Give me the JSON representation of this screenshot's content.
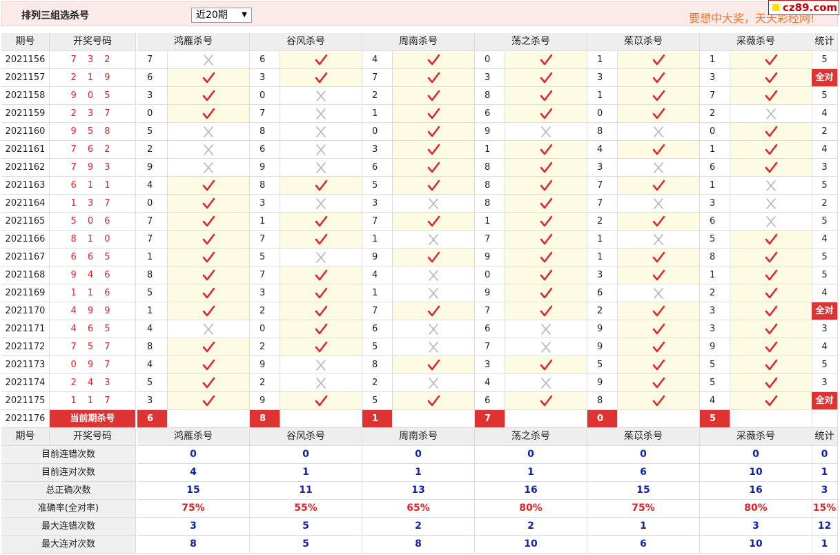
{
  "header": {
    "title": "排列三组选杀号",
    "period_select": "近20期",
    "slogan": "要想中大奖，天天彩经网!",
    "logo": "cz89.com"
  },
  "columns": {
    "period": "期号",
    "draw": "开奖号码",
    "experts": [
      "鸿雁杀号",
      "谷风杀号",
      "周南杀号",
      "荡之杀号",
      "茱苡杀号",
      "采薇杀号"
    ],
    "stat": "统计"
  },
  "rows": [
    {
      "period": "2021156",
      "draw": "7 3 2",
      "kills": [
        [
          7,
          0
        ],
        [
          6,
          1
        ],
        [
          4,
          1
        ],
        [
          0,
          1
        ],
        [
          1,
          1
        ],
        [
          1,
          1
        ]
      ],
      "stat": "5"
    },
    {
      "period": "2021157",
      "draw": "2 1 9",
      "kills": [
        [
          6,
          1
        ],
        [
          3,
          1
        ],
        [
          7,
          1
        ],
        [
          3,
          1
        ],
        [
          3,
          1
        ],
        [
          3,
          1
        ]
      ],
      "stat": "全对"
    },
    {
      "period": "2021158",
      "draw": "9 0 5",
      "kills": [
        [
          3,
          1
        ],
        [
          0,
          0
        ],
        [
          2,
          1
        ],
        [
          8,
          1
        ],
        [
          1,
          1
        ],
        [
          7,
          1
        ]
      ],
      "stat": "5"
    },
    {
      "period": "2021159",
      "draw": "2 3 7",
      "kills": [
        [
          0,
          1
        ],
        [
          7,
          0
        ],
        [
          1,
          1
        ],
        [
          6,
          1
        ],
        [
          0,
          1
        ],
        [
          2,
          0
        ]
      ],
      "stat": "4"
    },
    {
      "period": "2021160",
      "draw": "9 5 8",
      "kills": [
        [
          5,
          0
        ],
        [
          8,
          0
        ],
        [
          0,
          1
        ],
        [
          9,
          0
        ],
        [
          8,
          0
        ],
        [
          0,
          1
        ]
      ],
      "stat": "2"
    },
    {
      "period": "2021161",
      "draw": "7 6 2",
      "kills": [
        [
          2,
          0
        ],
        [
          6,
          0
        ],
        [
          3,
          1
        ],
        [
          1,
          1
        ],
        [
          4,
          1
        ],
        [
          1,
          1
        ]
      ],
      "stat": "4"
    },
    {
      "period": "2021162",
      "draw": "7 9 3",
      "kills": [
        [
          9,
          0
        ],
        [
          9,
          0
        ],
        [
          6,
          1
        ],
        [
          8,
          1
        ],
        [
          3,
          0
        ],
        [
          6,
          1
        ]
      ],
      "stat": "3"
    },
    {
      "period": "2021163",
      "draw": "6 1 1",
      "kills": [
        [
          4,
          1
        ],
        [
          8,
          1
        ],
        [
          5,
          1
        ],
        [
          8,
          1
        ],
        [
          7,
          1
        ],
        [
          1,
          0
        ]
      ],
      "stat": "5"
    },
    {
      "period": "2021164",
      "draw": "1 3 7",
      "kills": [
        [
          0,
          1
        ],
        [
          3,
          0
        ],
        [
          3,
          0
        ],
        [
          8,
          1
        ],
        [
          7,
          0
        ],
        [
          3,
          0
        ]
      ],
      "stat": "2"
    },
    {
      "period": "2021165",
      "draw": "5 0 6",
      "kills": [
        [
          7,
          1
        ],
        [
          1,
          1
        ],
        [
          7,
          1
        ],
        [
          1,
          1
        ],
        [
          2,
          1
        ],
        [
          6,
          0
        ]
      ],
      "stat": "5"
    },
    {
      "period": "2021166",
      "draw": "8 1 0",
      "kills": [
        [
          7,
          1
        ],
        [
          7,
          1
        ],
        [
          1,
          0
        ],
        [
          7,
          1
        ],
        [
          1,
          0
        ],
        [
          5,
          1
        ]
      ],
      "stat": "4"
    },
    {
      "period": "2021167",
      "draw": "6 6 5",
      "kills": [
        [
          1,
          1
        ],
        [
          5,
          0
        ],
        [
          9,
          1
        ],
        [
          9,
          1
        ],
        [
          1,
          1
        ],
        [
          8,
          1
        ]
      ],
      "stat": "5"
    },
    {
      "period": "2021168",
      "draw": "9 4 6",
      "kills": [
        [
          8,
          1
        ],
        [
          7,
          1
        ],
        [
          4,
          0
        ],
        [
          0,
          1
        ],
        [
          3,
          1
        ],
        [
          1,
          1
        ]
      ],
      "stat": "5"
    },
    {
      "period": "2021169",
      "draw": "1 1 6",
      "kills": [
        [
          5,
          1
        ],
        [
          3,
          1
        ],
        [
          1,
          0
        ],
        [
          9,
          1
        ],
        [
          6,
          0
        ],
        [
          2,
          1
        ]
      ],
      "stat": "4"
    },
    {
      "period": "2021170",
      "draw": "4 9 9",
      "kills": [
        [
          1,
          1
        ],
        [
          2,
          1
        ],
        [
          7,
          1
        ],
        [
          7,
          1
        ],
        [
          2,
          1
        ],
        [
          3,
          1
        ]
      ],
      "stat": "全对"
    },
    {
      "period": "2021171",
      "draw": "4 6 5",
      "kills": [
        [
          4,
          0
        ],
        [
          0,
          1
        ],
        [
          6,
          0
        ],
        [
          6,
          0
        ],
        [
          9,
          1
        ],
        [
          3,
          1
        ]
      ],
      "stat": "3"
    },
    {
      "period": "2021172",
      "draw": "7 5 7",
      "kills": [
        [
          8,
          1
        ],
        [
          2,
          1
        ],
        [
          5,
          0
        ],
        [
          7,
          0
        ],
        [
          9,
          1
        ],
        [
          9,
          1
        ]
      ],
      "stat": "4"
    },
    {
      "period": "2021173",
      "draw": "0 9 7",
      "kills": [
        [
          4,
          1
        ],
        [
          9,
          0
        ],
        [
          8,
          1
        ],
        [
          3,
          1
        ],
        [
          5,
          1
        ],
        [
          5,
          1
        ]
      ],
      "stat": "5"
    },
    {
      "period": "2021174",
      "draw": "2 4 3",
      "kills": [
        [
          5,
          1
        ],
        [
          2,
          0
        ],
        [
          2,
          0
        ],
        [
          4,
          0
        ],
        [
          9,
          1
        ],
        [
          5,
          1
        ]
      ],
      "stat": "3"
    },
    {
      "period": "2021175",
      "draw": "1 1 7",
      "kills": [
        [
          3,
          1
        ],
        [
          9,
          1
        ],
        [
          5,
          1
        ],
        [
          6,
          1
        ],
        [
          8,
          1
        ],
        [
          4,
          1
        ]
      ],
      "stat": "全对"
    }
  ],
  "current": {
    "period": "2021176",
    "label": "当前期杀号",
    "kills": [
      "6",
      "8",
      "1",
      "7",
      "0",
      "5"
    ]
  },
  "stats": [
    {
      "label": "目前连错次数",
      "values": [
        "0",
        "0",
        "0",
        "0",
        "0",
        "0"
      ],
      "total": "0"
    },
    {
      "label": "目前连对次数",
      "values": [
        "4",
        "1",
        "1",
        "1",
        "6",
        "10"
      ],
      "total": "1"
    },
    {
      "label": "总正确次数",
      "values": [
        "15",
        "11",
        "13",
        "16",
        "15",
        "16"
      ],
      "total": "3"
    },
    {
      "label": "准确率(全对率)",
      "values": [
        "75%",
        "55%",
        "65%",
        "80%",
        "75%",
        "80%"
      ],
      "total": "15%"
    },
    {
      "label": "最大连错次数",
      "values": [
        "3",
        "5",
        "2",
        "2",
        "1",
        "3"
      ],
      "total": "12"
    },
    {
      "label": "最大连对次数",
      "values": [
        "8",
        "5",
        "8",
        "10",
        "6",
        "10"
      ],
      "total": "1"
    }
  ],
  "colors": {
    "check": "#e0262c",
    "cross": "#b5b5b5",
    "badge": "#d33333",
    "highlight": "#fdfbe3"
  }
}
